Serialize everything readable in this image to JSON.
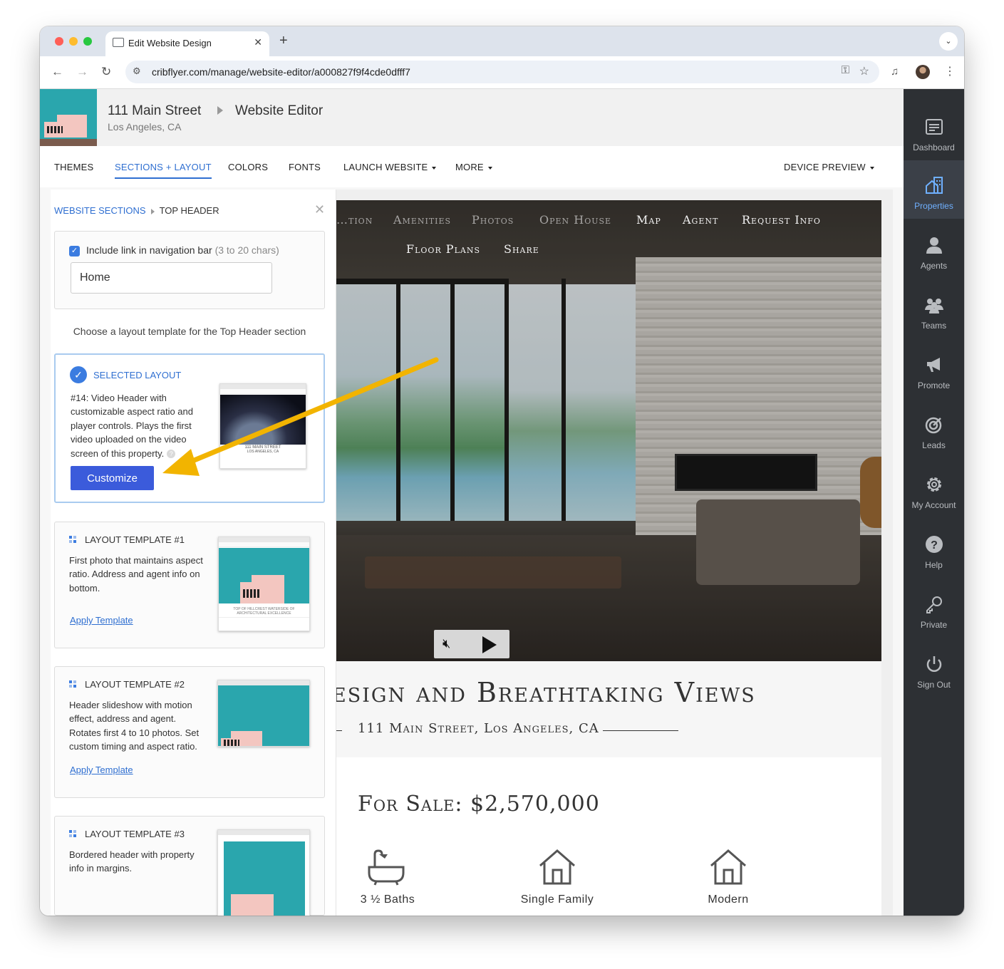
{
  "browser": {
    "tab_title": "Edit Website Design",
    "url": "cribflyer.com/manage/website-editor/a000827f9f4cde0dfff7"
  },
  "header": {
    "property_name": "111 Main Street",
    "page_title": "Website Editor",
    "city": "Los Angeles, CA"
  },
  "menu": {
    "themes": "THEMES",
    "sections_layout": "SECTIONS + LAYOUT",
    "colors": "COLORS",
    "fonts": "FONTS",
    "launch_website": "LAUNCH WEBSITE",
    "more": "MORE",
    "device_preview": "DEVICE PREVIEW"
  },
  "panel": {
    "breadcrumb_root": "WEBSITE SECTIONS",
    "breadcrumb_current": "TOP HEADER",
    "nav_checkbox_label": "Include link in navigation bar",
    "nav_checkbox_hint": "(3 to 20 chars)",
    "nav_input_value": "Home",
    "nav_checkbox_checked": true,
    "choose_text": "Choose a layout template for the Top Header section",
    "selected": {
      "title": "SELECTED LAYOUT",
      "description": "#14: Video Header with customizable aspect ratio and player controls. Plays the first video uploaded on the video screen of this property.",
      "help": "?",
      "customize_label": "Customize",
      "thumb_caption_1": "111 MAIN STREET",
      "thumb_caption_2": "LOS ANGELES, CA"
    },
    "templates": [
      {
        "title": "LAYOUT TEMPLATE #1",
        "description": "First photo that maintains aspect ratio. Address and agent info on bottom.",
        "link": "Apply Template",
        "thumb_caption": "TOP OF HILLCREST WATERSIDE OF ARCHITECTURAL EXCELLENCE"
      },
      {
        "title": "LAYOUT TEMPLATE #2",
        "description": "Header slideshow with motion effect, address and agent. Rotates first 4 to 10 photos. Set custom timing and aspect ratio.",
        "link": "Apply Template"
      },
      {
        "title": "LAYOUT TEMPLATE #3",
        "description": "Bordered header with property info in margins."
      }
    ]
  },
  "preview": {
    "nav_items_row1": [
      "…tion",
      "Amenities",
      "Photos",
      "Open House",
      "Map",
      "Agent",
      "Request Info"
    ],
    "nav_items_row2": [
      "Floor Plans",
      "Share"
    ],
    "hero_title": "esign and Breathtaking Views",
    "hero_address": "111 Main Street, Los Angeles, CA",
    "price": "For Sale: $2,570,000",
    "features": [
      {
        "icon": "bathtub-icon",
        "label": "3 ½ Baths"
      },
      {
        "icon": "house-icon",
        "label": "Single Family"
      },
      {
        "icon": "house-icon",
        "label": "Modern"
      }
    ]
  },
  "sidebar": {
    "items": [
      {
        "label": "Dashboard",
        "icon": "dashboard-icon",
        "active": false
      },
      {
        "label": "Properties",
        "icon": "properties-icon",
        "active": true
      },
      {
        "label": "Agents",
        "icon": "agent-icon",
        "active": false
      },
      {
        "label": "Teams",
        "icon": "teams-icon",
        "active": false
      },
      {
        "label": "Promote",
        "icon": "megaphone-icon",
        "active": false
      },
      {
        "label": "Leads",
        "icon": "target-icon",
        "active": false
      },
      {
        "label": "My Account",
        "icon": "gear-icon",
        "active": false
      },
      {
        "label": "Help",
        "icon": "help-icon",
        "active": false
      },
      {
        "label": "Private",
        "icon": "key-icon",
        "active": false
      },
      {
        "label": "Sign Out",
        "icon": "power-icon",
        "active": false
      }
    ]
  },
  "colors": {
    "accent": "#2f6fd1",
    "primary_button": "#3b5bdb",
    "sidebar_bg": "#2d3034",
    "sidebar_active_label": "#6fb0ff",
    "annotation_arrow": "#f2b400"
  }
}
